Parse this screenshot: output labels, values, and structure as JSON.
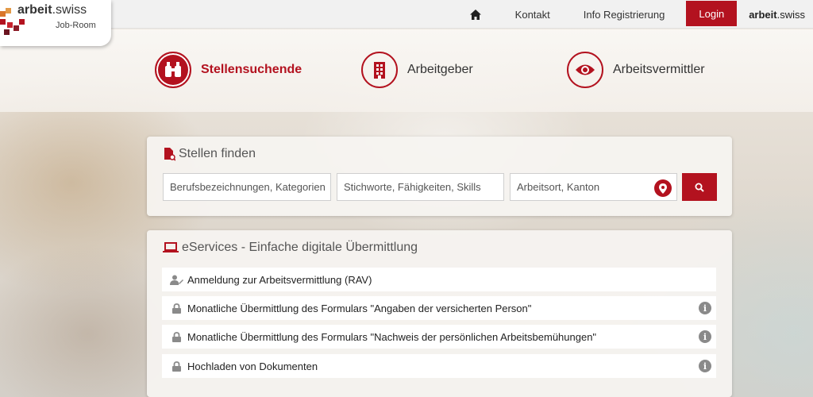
{
  "logo": {
    "name_main": "arbeit",
    "name_suffix": ".swiss",
    "sub": "Job-Room"
  },
  "nav": {
    "home_icon": "home-icon",
    "contact": "Kontakt",
    "info_registration": "Info Registrierung",
    "login": "Login",
    "brand_bold": "arbeit",
    "brand_rest": ".swiss"
  },
  "roles": [
    {
      "label": "Stellensuchende",
      "icon": "binoculars-icon",
      "active": true
    },
    {
      "label": "Arbeitgeber",
      "icon": "building-icon",
      "active": false
    },
    {
      "label": "Arbeitsvermittler",
      "icon": "eye-icon",
      "active": false
    }
  ],
  "job_search": {
    "title": "Stellen finden",
    "occupation_placeholder": "Berufsbezeichnungen, Kategorien",
    "keywords_placeholder": "Stichworte, Fähigkeiten, Skills",
    "location_placeholder": "Arbeitsort, Kanton"
  },
  "eservices": {
    "title": "eServices - Einfache digitale Übermittlung",
    "items": [
      {
        "label": "Anmeldung zur Arbeitsvermittlung (RAV)",
        "icon": "user-edit-icon",
        "info": false
      },
      {
        "label": "Monatliche Übermittlung des Formulars \"Angaben der versicherten Person\"",
        "icon": "lock-icon",
        "info": true
      },
      {
        "label": "Monatliche Übermittlung des Formulars \"Nachweis der persönlichen Arbeitsbemühungen\"",
        "icon": "lock-icon",
        "info": true
      },
      {
        "label": "Hochladen von Dokumenten",
        "icon": "lock-icon",
        "info": true
      }
    ]
  },
  "colors": {
    "accent": "#b3121f",
    "topbar": "#f1f1f1",
    "info_icon": "#8a8a8a"
  }
}
